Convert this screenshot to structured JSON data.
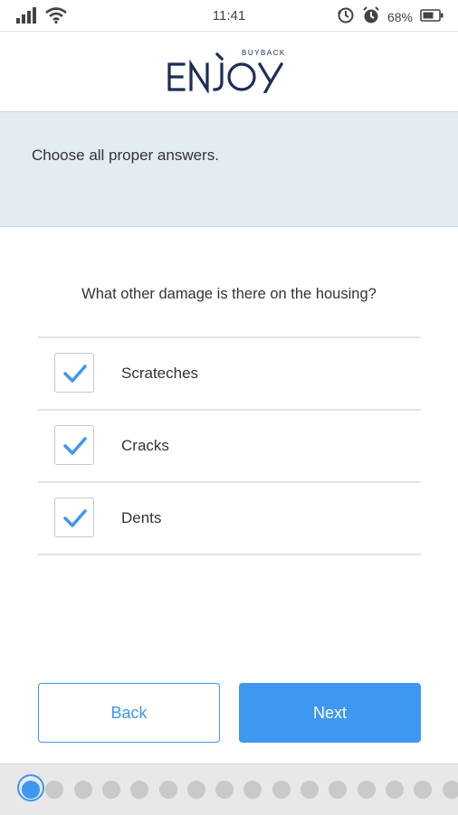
{
  "status_bar": {
    "time": "11:41",
    "battery_percent": "68%",
    "icons": [
      "signal-icon",
      "wifi-icon",
      "sync-icon",
      "alarm-icon",
      "battery-icon"
    ]
  },
  "header": {
    "logo_text": "ENJOY",
    "logo_subtext": "BUYBACK"
  },
  "instruction": "Choose all proper answers.",
  "question": "What other damage is there on the housing?",
  "options": [
    {
      "label": "Scrateches",
      "checked": true
    },
    {
      "label": "Cracks",
      "checked": true
    },
    {
      "label": "Dents",
      "checked": true
    }
  ],
  "buttons": {
    "back": "Back",
    "next": "Next"
  },
  "progress": {
    "total_steps": 16,
    "current_step": 1
  },
  "colors": {
    "accent": "#3e97f0",
    "logo": "#1c2d57",
    "info_panel": "#e3ecf2"
  }
}
